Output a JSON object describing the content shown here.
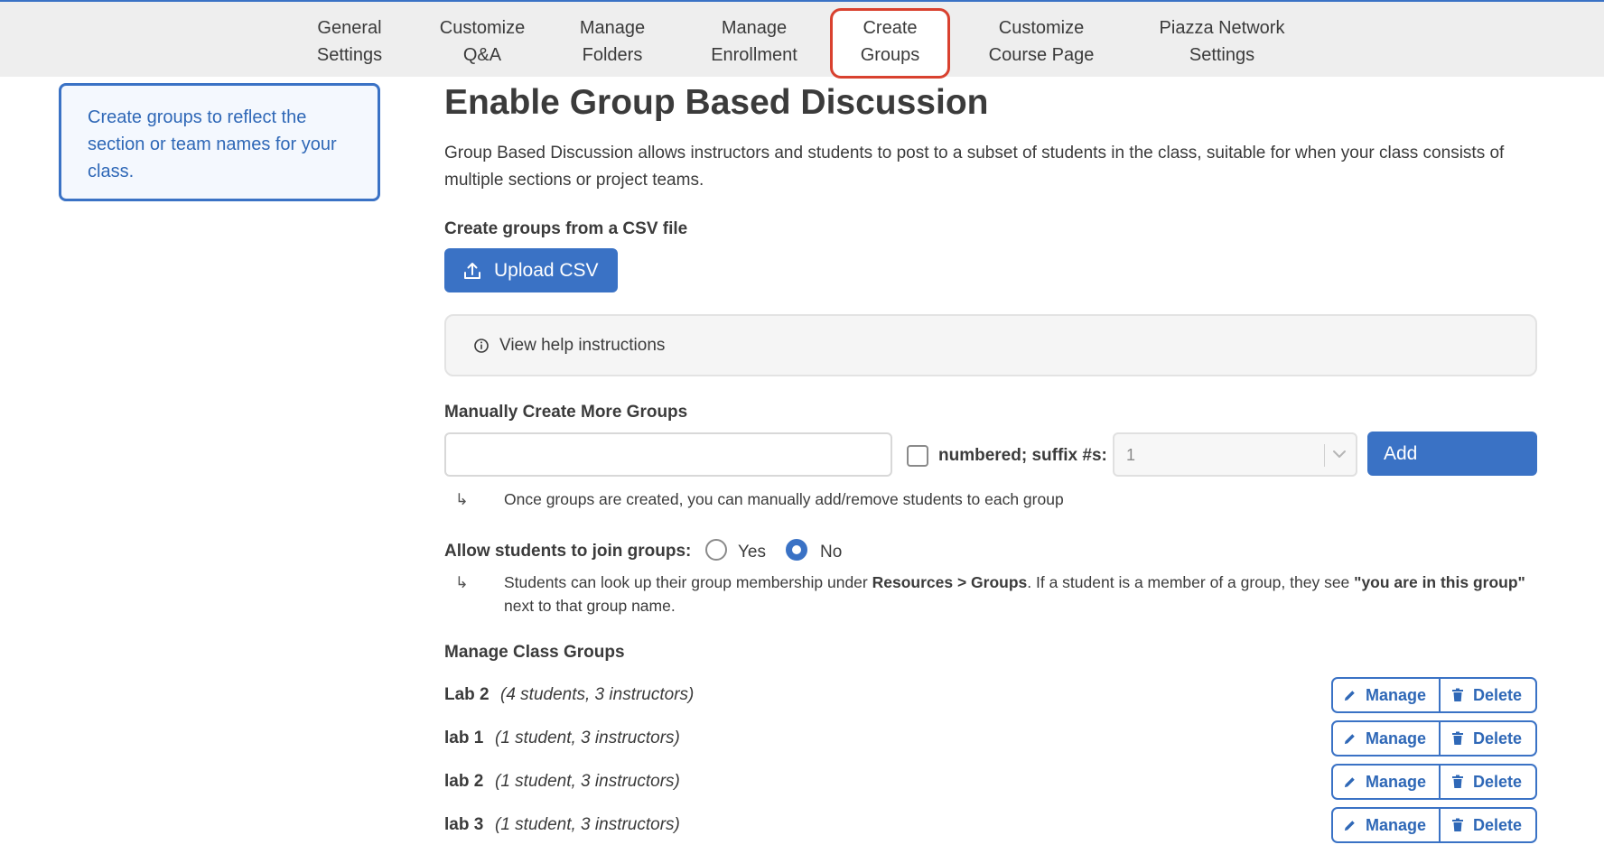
{
  "nav": {
    "items": [
      {
        "line1": "General",
        "line2": "Settings"
      },
      {
        "line1": "Customize",
        "line2": "Q&A"
      },
      {
        "line1": "Manage",
        "line2": "Folders"
      },
      {
        "line1": "Manage",
        "line2": "Enrollment"
      },
      {
        "line1": "Create",
        "line2": "Groups"
      },
      {
        "line1": "Customize",
        "line2": "Course Page"
      },
      {
        "line1": "Piazza Network",
        "line2": "Settings"
      }
    ],
    "active_index": 4,
    "accent_color": "#3a72c5",
    "highlight_color": "#d9412f"
  },
  "sidebar": {
    "hint": "Create groups to reflect the section or team names for your class."
  },
  "main": {
    "title": "Enable Group Based Discussion",
    "description": "Group Based Discussion allows instructors and students to post to a subset of students in the class, suitable for when your class consists of multiple sections or project teams.",
    "csv": {
      "label": "Create groups from a CSV file",
      "upload_label": "Upload CSV",
      "upload_icon": "upload-icon"
    },
    "help": {
      "label": "View help instructions",
      "icon": "info-icon"
    },
    "manual": {
      "label": "Manually Create More Groups",
      "input_value": "",
      "numbered_label": "numbered; suffix #s:",
      "numbered_checked": false,
      "suffix_value": "1",
      "add_label": "Add",
      "note_arrow": "↳",
      "note": "Once groups are created, you can manually add/remove students to each group"
    },
    "join": {
      "label": "Allow students to join groups:",
      "yes_label": "Yes",
      "no_label": "No",
      "selected": "No",
      "note_arrow": "↳",
      "note_part1": "Students can look up their group membership under ",
      "note_bold1": "Resources > Groups",
      "note_part2": ". If a student is a member of a group, they see ",
      "note_bold2": "\"you are in this group\"",
      "note_part3": " next to that group name."
    },
    "groups": {
      "label": "Manage Class Groups",
      "manage_label": "Manage",
      "delete_label": "Delete",
      "rows": [
        {
          "name": "Lab 2",
          "meta": "(4 students, 3 instructors)"
        },
        {
          "name": "lab 1",
          "meta": "(1 student, 3 instructors)"
        },
        {
          "name": "lab 2",
          "meta": "(1 student, 3 instructors)"
        },
        {
          "name": "lab 3",
          "meta": "(1 student, 3 instructors)"
        }
      ]
    }
  }
}
